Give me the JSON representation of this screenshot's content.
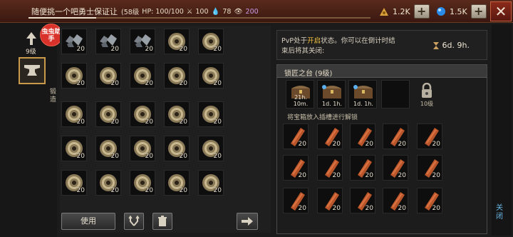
{
  "header": {
    "quest_text": "随便挑一个吧勇士保证让",
    "level": "(58级",
    "hp_label": "HP: 100/100",
    "attack": "100",
    "defense": "78",
    "mana": "200",
    "currency1": "1.2K",
    "currency2": "1.5K",
    "close": "✕"
  },
  "left": {
    "level_label": "9级",
    "helper_badge": "虫虫助手",
    "craft_tab": "锻造"
  },
  "grid": {
    "rows": [
      [
        "ore",
        "ore",
        "ore",
        "coil",
        "coil"
      ],
      [
        "coil",
        "coil",
        "coil",
        "coil",
        "coil"
      ],
      [
        "coil",
        "coil",
        "coil",
        "coil",
        "coil"
      ],
      [
        "coil",
        "coil",
        "coil",
        "coil",
        "coil"
      ],
      [
        "coil",
        "coil",
        "coil",
        "coil",
        "coil"
      ]
    ],
    "qty": "20"
  },
  "buttons": {
    "use": "使用"
  },
  "pvp": {
    "line1_a": "PvP处于",
    "line1_b": "开启",
    "line1_c": "状态。你可以在倒计时结",
    "line2": "束后将其关闭:",
    "timer": "6d. 9h."
  },
  "locksmith": {
    "title": "锁匠之台 (9级)",
    "chests": [
      "21h. 10m.",
      "1d. 1h.",
      "1d. 1h."
    ],
    "lock_level": "10级",
    "hint": "将宝箱放入插槽进行解锁",
    "wood_qty": "20"
  },
  "right_close": "关闭",
  "colors": {
    "accent": "#c89a4a",
    "pvp_on": "#f0c040",
    "mana": "#c89ae8",
    "close_bg": "#8a2a1a"
  }
}
